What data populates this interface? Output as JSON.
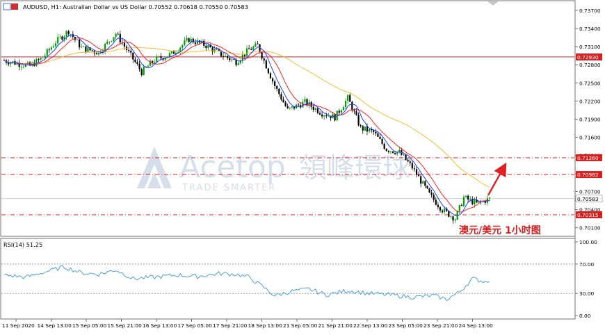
{
  "header": {
    "symbol_line": "AUDUSD, H1:  Australian Dollar vs US Dollar  0.70552 0.70618 0.70550 0.70583"
  },
  "watermark": {
    "brand": "Acetop",
    "brand_cn": "領峰環球",
    "tagline": "TRADE SMARTER"
  },
  "annotation": {
    "text": "澳元/美元  1小时图"
  },
  "colors": {
    "bull": "#00a000",
    "bear": "#000000",
    "ma_fast": "#1e3cff",
    "ma_mid": "#ff2020",
    "ma_slow": "#f0c030",
    "level_line": "#d62020",
    "rsi_line": "#4aa0e0",
    "arrow": "#e02020"
  },
  "chart_data": [
    {
      "type": "candlestick",
      "symbol": "AUDUSD",
      "timeframe": "H1",
      "ohlc_current": {
        "open": 0.70552,
        "high": 0.70618,
        "low": 0.7055,
        "close": 0.70583
      },
      "yticks": [
        "0.73700",
        "0.73400",
        "0.73100",
        "0.72800",
        "0.72500",
        "0.72200",
        "0.71900",
        "0.71600",
        "0.71300",
        "0.71000",
        "0.70700",
        "0.70400",
        "0.70100"
      ],
      "ylim": [
        0.6997,
        0.7385
      ],
      "x_labels": [
        "11 Sep 2020",
        "14 Sep 13:00",
        "15 Sep 05:00",
        "15 Sep 21:00",
        "16 Sep 13:00",
        "17 Sep 05:00",
        "17 Sep 21:00",
        "18 Sep 13:00",
        "21 Sep 05:00",
        "21 Sep 21:00",
        "22 Sep 13:00",
        "23 Sep 05:00",
        "23 Sep 21:00",
        "24 Sep 13:00"
      ],
      "path_points": [
        [
          0,
          0.7287
        ],
        [
          12,
          0.7278
        ],
        [
          18,
          0.7292
        ],
        [
          24,
          0.7318
        ],
        [
          30,
          0.7336
        ],
        [
          36,
          0.7308
        ],
        [
          44,
          0.73
        ],
        [
          52,
          0.7332
        ],
        [
          58,
          0.73
        ],
        [
          64,
          0.7268
        ],
        [
          70,
          0.7288
        ],
        [
          78,
          0.7298
        ],
        [
          86,
          0.7322
        ],
        [
          94,
          0.7312
        ],
        [
          102,
          0.7295
        ],
        [
          108,
          0.7285
        ],
        [
          114,
          0.7305
        ],
        [
          118,
          0.7312
        ],
        [
          126,
          0.7245
        ],
        [
          132,
          0.7205
        ],
        [
          140,
          0.7218
        ],
        [
          148,
          0.72
        ],
        [
          154,
          0.7193
        ],
        [
          160,
          0.7225
        ],
        [
          166,
          0.7175
        ],
        [
          172,
          0.7168
        ],
        [
          178,
          0.714
        ],
        [
          184,
          0.7135
        ],
        [
          190,
          0.711
        ],
        [
          198,
          0.7065
        ],
        [
          204,
          0.704
        ],
        [
          210,
          0.7025
        ],
        [
          214,
          0.706
        ],
        [
          220,
          0.705
        ],
        [
          226,
          0.7058
        ]
      ],
      "levels": [
        {
          "value": 0.7293,
          "label": "0.72930",
          "style": "solid"
        },
        {
          "value": 0.7126,
          "label": "0.71260",
          "style": "dashdot"
        },
        {
          "value": 0.70982,
          "label": "0.70982",
          "style": "dashdot"
        },
        {
          "value": 0.70315,
          "label": "0.70315",
          "style": "dashdot"
        },
        {
          "value": 0.70583,
          "label": "0.70583",
          "style": "current"
        }
      ]
    },
    {
      "type": "line",
      "indicator": "RSI(14)",
      "value_label": "51.25",
      "title": "RSI(14) 51.25",
      "yticks": [
        "100.00",
        "70.00",
        "30.00",
        "0.00"
      ],
      "ylim": [
        0,
        100
      ],
      "levels": [
        70,
        30
      ],
      "path_points": [
        [
          0,
          55
        ],
        [
          10,
          52
        ],
        [
          20,
          60
        ],
        [
          28,
          66
        ],
        [
          36,
          58
        ],
        [
          44,
          56
        ],
        [
          52,
          62
        ],
        [
          60,
          50
        ],
        [
          70,
          52
        ],
        [
          80,
          55
        ],
        [
          90,
          53
        ],
        [
          100,
          57
        ],
        [
          108,
          56
        ],
        [
          114,
          52
        ],
        [
          120,
          40
        ],
        [
          126,
          27
        ],
        [
          134,
          33
        ],
        [
          142,
          36
        ],
        [
          150,
          28
        ],
        [
          160,
          34
        ],
        [
          170,
          30
        ],
        [
          180,
          28
        ],
        [
          190,
          25
        ],
        [
          200,
          27
        ],
        [
          206,
          22
        ],
        [
          212,
          32
        ],
        [
          218,
          50
        ],
        [
          224,
          46
        ],
        [
          228,
          52
        ]
      ]
    }
  ]
}
